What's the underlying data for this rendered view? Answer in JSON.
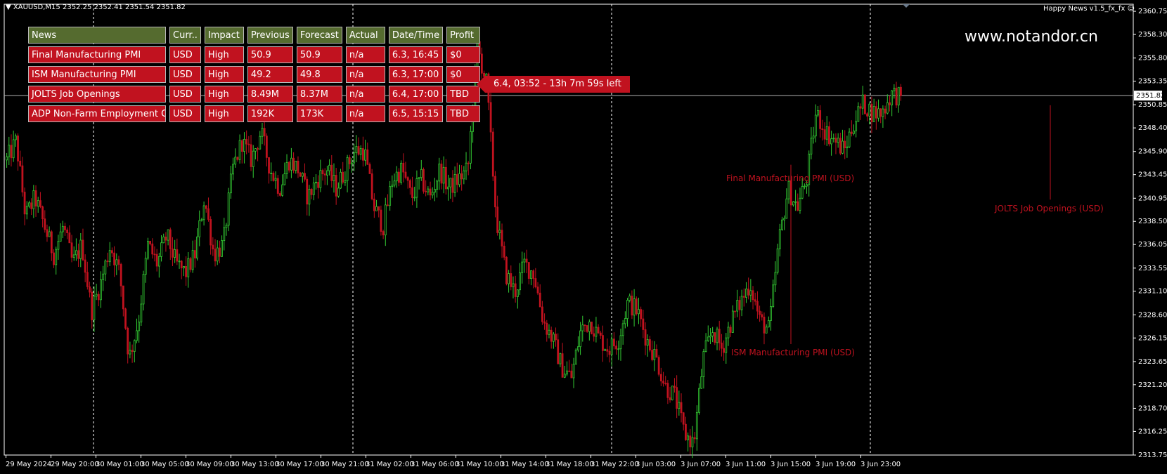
{
  "symbol_info": "XAUUSD,M15  2352.25 2352.41 2351.54 2351.82",
  "indicator_name": "Happy News v1.5_fx_fx",
  "watermark": "www.notandor.cn",
  "countdown": "6.4, 03:52 - 13h 7m 59s left",
  "colors": {
    "background": "#000000",
    "bull": "#33cc33",
    "bear": "#c1121f",
    "table_header": "#556b2f",
    "table_row": "#c1121f"
  },
  "news_table": {
    "headers": [
      "News",
      "Curr..",
      "Impact",
      "Previous",
      "Forecast",
      "Actual",
      "Date/Time",
      "Profit"
    ],
    "rows": [
      [
        "Final Manufacturing PMI",
        "USD",
        "High",
        "50.9",
        "50.9",
        "n/a",
        "6.3, 16:45",
        "$0"
      ],
      [
        "ISM Manufacturing PMI",
        "USD",
        "High",
        "49.2",
        "49.8",
        "n/a",
        "6.3, 17:00",
        "$0"
      ],
      [
        "JOLTS Job Openings",
        "USD",
        "High",
        "8.49M",
        "8.37M",
        "n/a",
        "6.4, 17:00",
        "TBD"
      ],
      [
        "ADP Non-Farm Employment Change",
        "USD",
        "High",
        "192K",
        "173K",
        "n/a",
        "6.5, 15:15",
        "TBD"
      ]
    ]
  },
  "event_labels": {
    "final_pmi": "Final Manufacturing PMI (USD)",
    "ism_pmi": "ISM Manufacturing PMI (USD)",
    "jolts": "JOLTS Job Openings (USD)"
  },
  "chart_data": {
    "type": "candlestick",
    "symbol": "XAUUSD",
    "timeframe": "M15",
    "ohlc_last": {
      "open": 2352.25,
      "high": 2352.41,
      "low": 2351.54,
      "close": 2351.82
    },
    "current_price": "2351.82",
    "ylim": [
      2313.75,
      2361.5
    ],
    "y_ticks": [
      "2360.75",
      "2358.30",
      "2355.80",
      "2353.35",
      "2350.85",
      "2348.40",
      "2345.90",
      "2343.45",
      "2340.95",
      "2338.50",
      "2336.05",
      "2333.55",
      "2331.10",
      "2328.60",
      "2326.15",
      "2323.65",
      "2321.20",
      "2318.70",
      "2316.25",
      "2313.75"
    ],
    "x_ticks": [
      "29 May 2024",
      "29 May 20:00",
      "30 May 01:00",
      "30 May 05:00",
      "30 May 09:00",
      "30 May 13:00",
      "30 May 17:00",
      "30 May 21:00",
      "31 May 02:00",
      "31 May 06:00",
      "31 May 10:00",
      "31 May 14:00",
      "31 May 18:00",
      "31 May 22:00",
      "3 Jun 03:00",
      "3 Jun 07:00",
      "3 Jun 11:00",
      "3 Jun 15:00",
      "3 Jun 19:00",
      "3 Jun 23:00"
    ],
    "path": [
      2345,
      2347,
      2339,
      2341,
      2338,
      2335,
      2338,
      2334,
      2336,
      2329,
      2332,
      2336,
      2333,
      2324,
      2328,
      2336,
      2334,
      2337,
      2334,
      2333,
      2335,
      2341,
      2335,
      2336,
      2344,
      2347,
      2345,
      2348,
      2344,
      2342,
      2345,
      2344,
      2341,
      2343,
      2344,
      2342,
      2344,
      2346,
      2346,
      2340,
      2338,
      2343,
      2344,
      2341,
      2343,
      2341,
      2344,
      2342,
      2343,
      2344,
      2357,
      2353,
      2339,
      2333,
      2331,
      2334,
      2333,
      2328,
      2326,
      2323,
      2322,
      2327,
      2328,
      2326,
      2325,
      2326,
      2330,
      2329,
      2326,
      2324,
      2321,
      2320,
      2316,
      2315,
      2324,
      2327,
      2325,
      2328,
      2330,
      2332,
      2328,
      2327,
      2336,
      2342,
      2340,
      2343,
      2350,
      2348,
      2347,
      2346,
      2349,
      2351,
      2350,
      2350,
      2352,
      2351.82
    ]
  }
}
